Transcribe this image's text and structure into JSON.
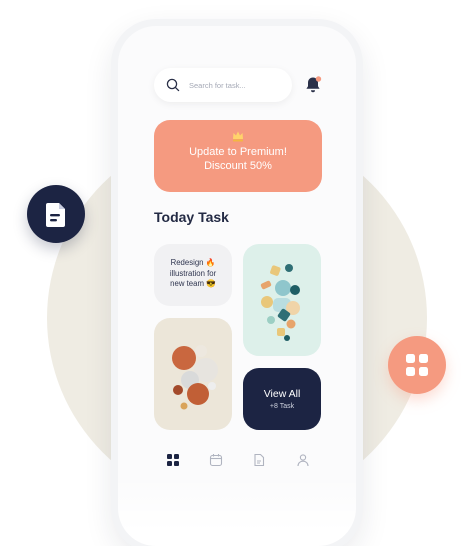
{
  "colors": {
    "accent": "#f59a80",
    "navy": "#1c2443",
    "background_circle": "#efece3",
    "mint": "#ddf0ea",
    "beige": "#ece6d9"
  },
  "search": {
    "placeholder": "Search for task..."
  },
  "icons": {
    "search": "search-icon",
    "notification": "bell-icon",
    "premium": "crown-icon",
    "nav": [
      "grid-icon",
      "calendar-icon",
      "document-icon",
      "user-icon"
    ],
    "left_badge": "document-icon",
    "right_badge": "grid-icon"
  },
  "premium_banner": {
    "line1": "Update to Premium!",
    "line2": "Discount 50%"
  },
  "section": {
    "title": "Today Task"
  },
  "cards": {
    "redesign": {
      "line1": "Redesign 🔥",
      "line2": "illustration for",
      "line3": "new team 😎"
    },
    "view_all": {
      "label": "View All",
      "count": "+8 Task"
    }
  }
}
